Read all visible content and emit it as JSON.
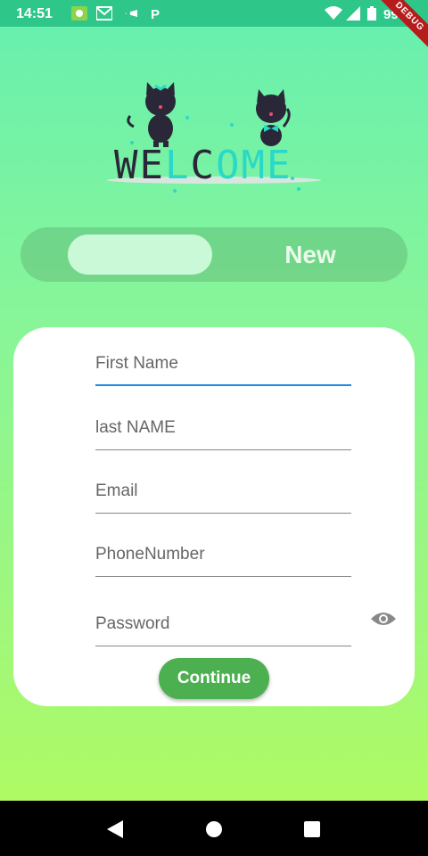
{
  "status_bar": {
    "time": "14:51",
    "battery": "99%",
    "left_icons": [
      "app-icon",
      "gmail-icon",
      "cast-icon",
      "p-icon"
    ],
    "right_icons": [
      "wifi-icon",
      "signal-icon",
      "battery-icon"
    ]
  },
  "debug_banner": "DEBUG",
  "hero": {
    "text": "WELCOME"
  },
  "toggle": {
    "active_label": "",
    "inactive_label": "New"
  },
  "form": {
    "first_name_placeholder": "First Name",
    "last_name_placeholder": "last NAME",
    "email_placeholder": "Email",
    "phone_placeholder": "PhoneNumber",
    "password_placeholder": "Password",
    "submit_label": "Continue"
  },
  "colors": {
    "accent": "#4caf50",
    "focus": "#1e88e5",
    "status_bar": "#2fc68a"
  }
}
